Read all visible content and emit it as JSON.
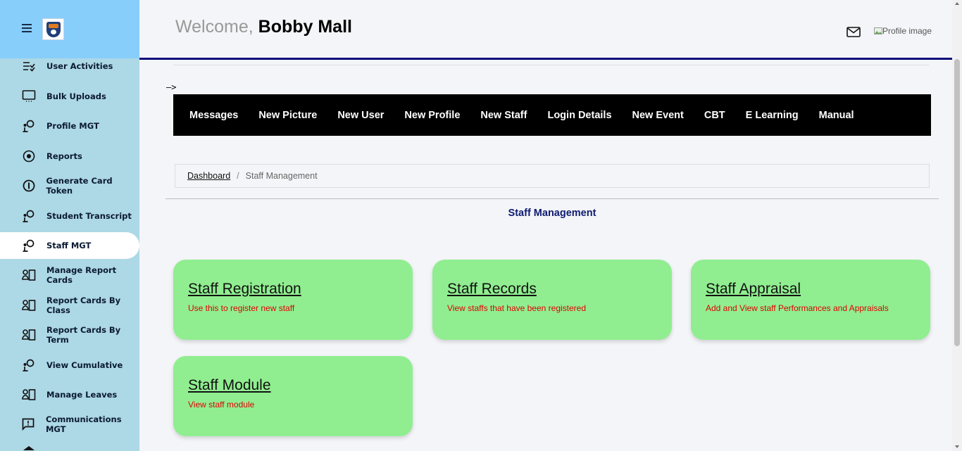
{
  "header": {
    "welcome_prefix": "Welcome,",
    "user_name": "Bobby Mall",
    "profile_image_alt": "Profile image"
  },
  "sidebar": {
    "items": [
      {
        "label": "User Activities",
        "icon": "checklist-icon"
      },
      {
        "label": "Bulk Uploads",
        "icon": "monitor-icon"
      },
      {
        "label": "Profile MGT",
        "icon": "user-gear-icon"
      },
      {
        "label": "Reports",
        "icon": "target-icon"
      },
      {
        "label": "Generate Card Token",
        "icon": "info-circle-icon"
      },
      {
        "label": "Student Transcript",
        "icon": "user-gear-icon"
      },
      {
        "label": "Staff MGT",
        "icon": "user-gear-icon",
        "active": true
      },
      {
        "label": "Manage Report Cards",
        "icon": "id-card-icon"
      },
      {
        "label": "Report Cards By Class",
        "icon": "id-card-icon"
      },
      {
        "label": "Report Cards By Term",
        "icon": "id-card-icon"
      },
      {
        "label": "View Cumulative",
        "icon": "user-gear-icon"
      },
      {
        "label": "Manage Leaves",
        "icon": "id-card-icon"
      },
      {
        "label": "Communications MGT",
        "icon": "chat-alert-icon"
      }
    ]
  },
  "arrow_text": "–>",
  "topmenu": [
    "Messages",
    "New Picture",
    "New User",
    "New Profile",
    "New Staff",
    "Login Details",
    "New Event",
    "CBT",
    "E Learning",
    "Manual"
  ],
  "breadcrumb": {
    "link": "Dashboard",
    "separator": "/",
    "current": "Staff Management"
  },
  "section_title": "Staff Management",
  "cards": [
    {
      "title": "Staff Registration",
      "desc": "Use this to register new staff"
    },
    {
      "title": "Staff Records",
      "desc": "View staffs that have been registered"
    },
    {
      "title": "Staff Appraisal",
      "desc": "Add and View staff Performances and Appraisals"
    },
    {
      "title": "Staff Module",
      "desc": "View staff module"
    }
  ],
  "colors": {
    "sidebar_bg": "#add8e6",
    "sidebar_head_bg": "#87cefa",
    "header_rule": "#0d0d7a",
    "card_bg": "#90ee90",
    "card_desc": "#e00000",
    "section_title": "#0d1a70"
  }
}
